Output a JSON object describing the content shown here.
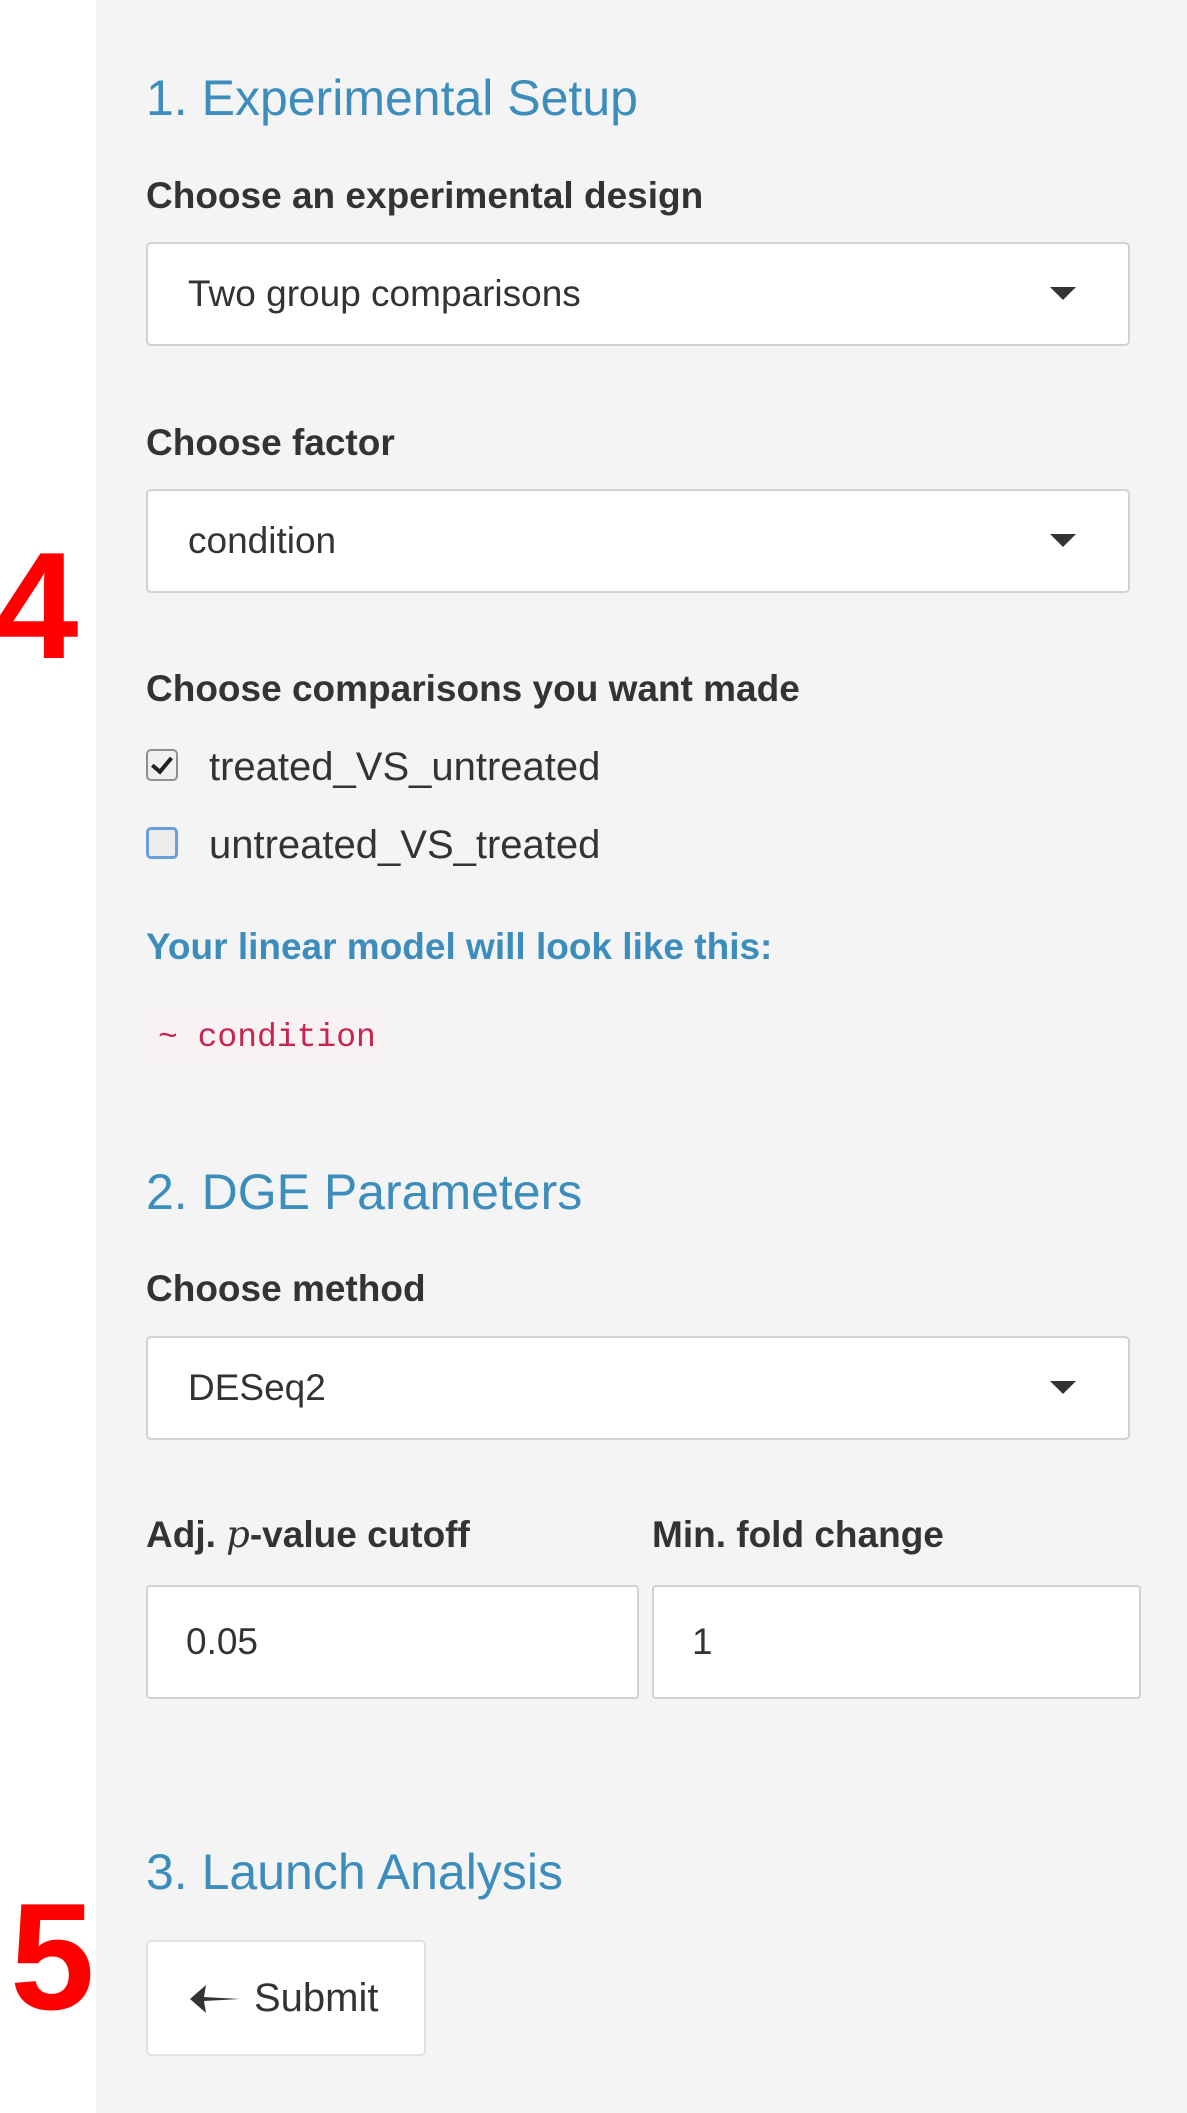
{
  "annotations": {
    "marker_4": "4",
    "marker_5": "5",
    "color": "#ff0000"
  },
  "setup": {
    "title": "1. Experimental Setup",
    "design_label": "Choose an experimental design",
    "design_value": "Two group comparisons",
    "factor_label": "Choose factor",
    "factor_value": "condition",
    "comparisons_label": "Choose comparisons you want made",
    "comparisons": [
      {
        "label": "treated_VS_untreated",
        "checked": true
      },
      {
        "label": "untreated_VS_treated",
        "checked": false
      }
    ],
    "model_note": "Your linear model will look like this:",
    "model_formula": "~ condition"
  },
  "dge": {
    "title": "2. DGE Parameters",
    "method_label": "Choose method",
    "method_value": "DESeq2",
    "pvalue_label_prefix": "Adj. ",
    "pvalue_label_p": "p",
    "pvalue_label_suffix": "-value cutoff",
    "pvalue_value": "0.05",
    "foldchange_label": "Min. fold change",
    "foldchange_value": "1"
  },
  "launch": {
    "title": "3. Launch Analysis",
    "submit_label": "Submit",
    "submit_icon": "paper-plane-icon"
  },
  "colors": {
    "accent": "#3c8dbc",
    "panel_bg": "#f4f4f4",
    "code_text": "#c7254e",
    "code_bg": "#f9f2f4"
  }
}
